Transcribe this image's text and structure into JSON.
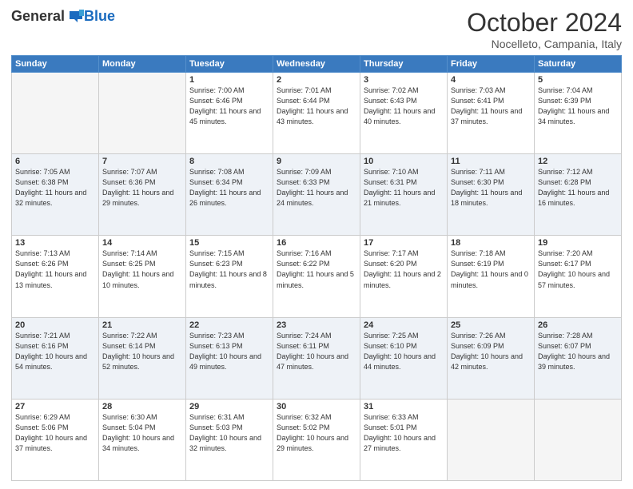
{
  "header": {
    "logo": {
      "general": "General",
      "blue": "Blue"
    },
    "title": "October 2024",
    "location": "Nocelleto, Campania, Italy"
  },
  "days_header": [
    "Sunday",
    "Monday",
    "Tuesday",
    "Wednesday",
    "Thursday",
    "Friday",
    "Saturday"
  ],
  "weeks": [
    [
      {
        "day": "",
        "empty": true
      },
      {
        "day": "",
        "empty": true
      },
      {
        "day": "1",
        "sunrise": "Sunrise: 7:00 AM",
        "sunset": "Sunset: 6:46 PM",
        "daylight": "Daylight: 11 hours and 45 minutes."
      },
      {
        "day": "2",
        "sunrise": "Sunrise: 7:01 AM",
        "sunset": "Sunset: 6:44 PM",
        "daylight": "Daylight: 11 hours and 43 minutes."
      },
      {
        "day": "3",
        "sunrise": "Sunrise: 7:02 AM",
        "sunset": "Sunset: 6:43 PM",
        "daylight": "Daylight: 11 hours and 40 minutes."
      },
      {
        "day": "4",
        "sunrise": "Sunrise: 7:03 AM",
        "sunset": "Sunset: 6:41 PM",
        "daylight": "Daylight: 11 hours and 37 minutes."
      },
      {
        "day": "5",
        "sunrise": "Sunrise: 7:04 AM",
        "sunset": "Sunset: 6:39 PM",
        "daylight": "Daylight: 11 hours and 34 minutes."
      }
    ],
    [
      {
        "day": "6",
        "sunrise": "Sunrise: 7:05 AM",
        "sunset": "Sunset: 6:38 PM",
        "daylight": "Daylight: 11 hours and 32 minutes."
      },
      {
        "day": "7",
        "sunrise": "Sunrise: 7:07 AM",
        "sunset": "Sunset: 6:36 PM",
        "daylight": "Daylight: 11 hours and 29 minutes."
      },
      {
        "day": "8",
        "sunrise": "Sunrise: 7:08 AM",
        "sunset": "Sunset: 6:34 PM",
        "daylight": "Daylight: 11 hours and 26 minutes."
      },
      {
        "day": "9",
        "sunrise": "Sunrise: 7:09 AM",
        "sunset": "Sunset: 6:33 PM",
        "daylight": "Daylight: 11 hours and 24 minutes."
      },
      {
        "day": "10",
        "sunrise": "Sunrise: 7:10 AM",
        "sunset": "Sunset: 6:31 PM",
        "daylight": "Daylight: 11 hours and 21 minutes."
      },
      {
        "day": "11",
        "sunrise": "Sunrise: 7:11 AM",
        "sunset": "Sunset: 6:30 PM",
        "daylight": "Daylight: 11 hours and 18 minutes."
      },
      {
        "day": "12",
        "sunrise": "Sunrise: 7:12 AM",
        "sunset": "Sunset: 6:28 PM",
        "daylight": "Daylight: 11 hours and 16 minutes."
      }
    ],
    [
      {
        "day": "13",
        "sunrise": "Sunrise: 7:13 AM",
        "sunset": "Sunset: 6:26 PM",
        "daylight": "Daylight: 11 hours and 13 minutes."
      },
      {
        "day": "14",
        "sunrise": "Sunrise: 7:14 AM",
        "sunset": "Sunset: 6:25 PM",
        "daylight": "Daylight: 11 hours and 10 minutes."
      },
      {
        "day": "15",
        "sunrise": "Sunrise: 7:15 AM",
        "sunset": "Sunset: 6:23 PM",
        "daylight": "Daylight: 11 hours and 8 minutes."
      },
      {
        "day": "16",
        "sunrise": "Sunrise: 7:16 AM",
        "sunset": "Sunset: 6:22 PM",
        "daylight": "Daylight: 11 hours and 5 minutes."
      },
      {
        "day": "17",
        "sunrise": "Sunrise: 7:17 AM",
        "sunset": "Sunset: 6:20 PM",
        "daylight": "Daylight: 11 hours and 2 minutes."
      },
      {
        "day": "18",
        "sunrise": "Sunrise: 7:18 AM",
        "sunset": "Sunset: 6:19 PM",
        "daylight": "Daylight: 11 hours and 0 minutes."
      },
      {
        "day": "19",
        "sunrise": "Sunrise: 7:20 AM",
        "sunset": "Sunset: 6:17 PM",
        "daylight": "Daylight: 10 hours and 57 minutes."
      }
    ],
    [
      {
        "day": "20",
        "sunrise": "Sunrise: 7:21 AM",
        "sunset": "Sunset: 6:16 PM",
        "daylight": "Daylight: 10 hours and 54 minutes."
      },
      {
        "day": "21",
        "sunrise": "Sunrise: 7:22 AM",
        "sunset": "Sunset: 6:14 PM",
        "daylight": "Daylight: 10 hours and 52 minutes."
      },
      {
        "day": "22",
        "sunrise": "Sunrise: 7:23 AM",
        "sunset": "Sunset: 6:13 PM",
        "daylight": "Daylight: 10 hours and 49 minutes."
      },
      {
        "day": "23",
        "sunrise": "Sunrise: 7:24 AM",
        "sunset": "Sunset: 6:11 PM",
        "daylight": "Daylight: 10 hours and 47 minutes."
      },
      {
        "day": "24",
        "sunrise": "Sunrise: 7:25 AM",
        "sunset": "Sunset: 6:10 PM",
        "daylight": "Daylight: 10 hours and 44 minutes."
      },
      {
        "day": "25",
        "sunrise": "Sunrise: 7:26 AM",
        "sunset": "Sunset: 6:09 PM",
        "daylight": "Daylight: 10 hours and 42 minutes."
      },
      {
        "day": "26",
        "sunrise": "Sunrise: 7:28 AM",
        "sunset": "Sunset: 6:07 PM",
        "daylight": "Daylight: 10 hours and 39 minutes."
      }
    ],
    [
      {
        "day": "27",
        "sunrise": "Sunrise: 6:29 AM",
        "sunset": "Sunset: 5:06 PM",
        "daylight": "Daylight: 10 hours and 37 minutes."
      },
      {
        "day": "28",
        "sunrise": "Sunrise: 6:30 AM",
        "sunset": "Sunset: 5:04 PM",
        "daylight": "Daylight: 10 hours and 34 minutes."
      },
      {
        "day": "29",
        "sunrise": "Sunrise: 6:31 AM",
        "sunset": "Sunset: 5:03 PM",
        "daylight": "Daylight: 10 hours and 32 minutes."
      },
      {
        "day": "30",
        "sunrise": "Sunrise: 6:32 AM",
        "sunset": "Sunset: 5:02 PM",
        "daylight": "Daylight: 10 hours and 29 minutes."
      },
      {
        "day": "31",
        "sunrise": "Sunrise: 6:33 AM",
        "sunset": "Sunset: 5:01 PM",
        "daylight": "Daylight: 10 hours and 27 minutes."
      },
      {
        "day": "",
        "empty": true
      },
      {
        "day": "",
        "empty": true
      }
    ]
  ]
}
